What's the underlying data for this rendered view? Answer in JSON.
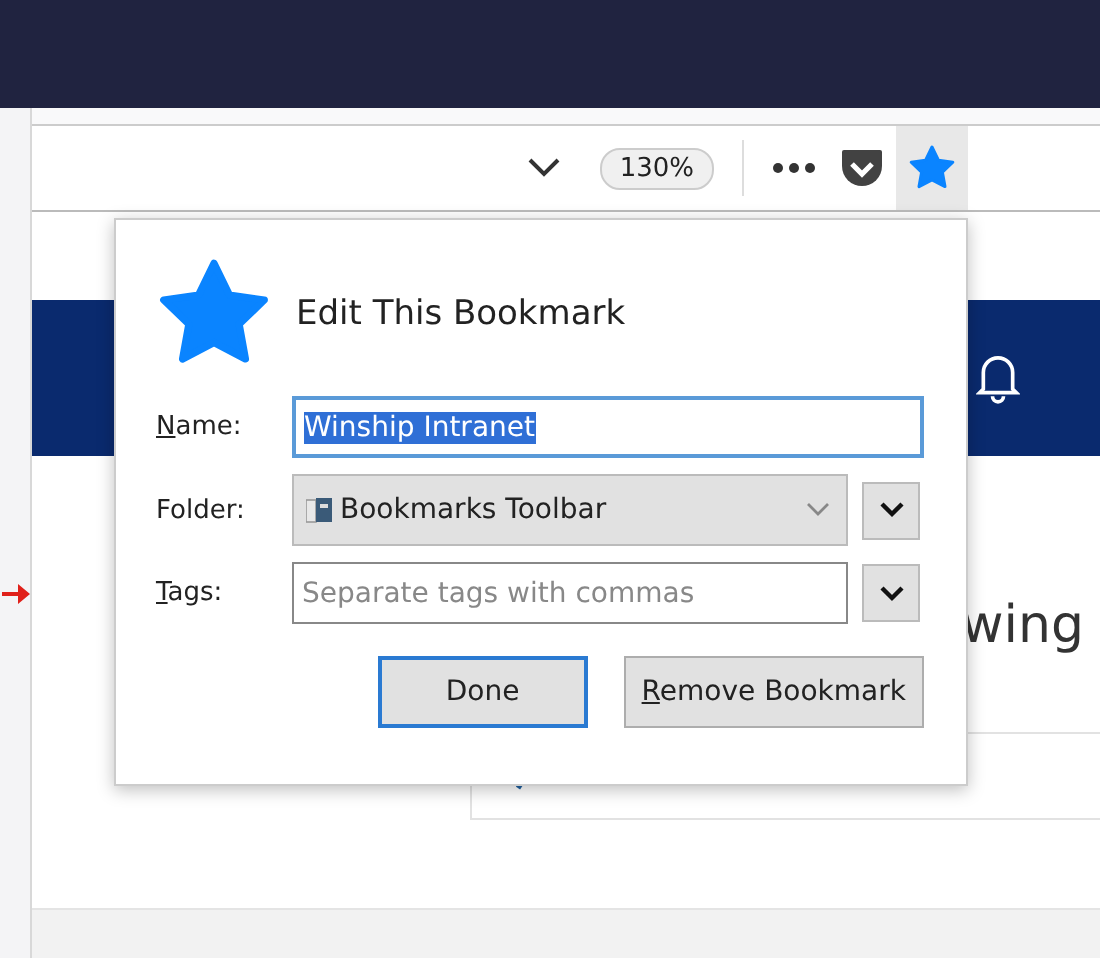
{
  "toolbar": {
    "zoom": "130%",
    "bookmarked": true
  },
  "page": {
    "partial_heading": "wing"
  },
  "popup": {
    "title": "Edit This Bookmark",
    "fields": [
      {
        "kind": "text",
        "label": "Name:",
        "mnemonic": true,
        "value": "Winship Intranet",
        "value_selected": true
      },
      {
        "kind": "select",
        "label": "Folder:",
        "mnemonic": false,
        "value": "Bookmarks Toolbar"
      },
      {
        "kind": "tags",
        "label": "Tags:",
        "mnemonic": true,
        "placeholder": "Separate tags with commas"
      }
    ],
    "buttons": [
      {
        "label": "Done",
        "mnemonic": false,
        "default": true
      },
      {
        "label": "Remove Bookmark",
        "mnemonic": true,
        "default": false
      }
    ]
  }
}
